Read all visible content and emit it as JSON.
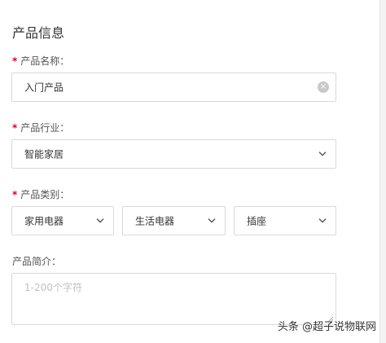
{
  "section": {
    "title": "产品信息"
  },
  "product_name": {
    "label": "产品名称：",
    "value": "入门产品"
  },
  "industry": {
    "label": "产品行业：",
    "value": "智能家居"
  },
  "category": {
    "label": "产品类别：",
    "values": [
      "家用电器",
      "生活电器",
      "插座"
    ]
  },
  "intro": {
    "label": "产品简介：",
    "placeholder": "1-200个字符"
  },
  "required_mark": "*",
  "watermark": "头条 @超子说物联网",
  "icons": {
    "clear": "clear-circle-icon",
    "dropdown": "chevron-down-icon",
    "resize": "resize-handle-icon"
  }
}
